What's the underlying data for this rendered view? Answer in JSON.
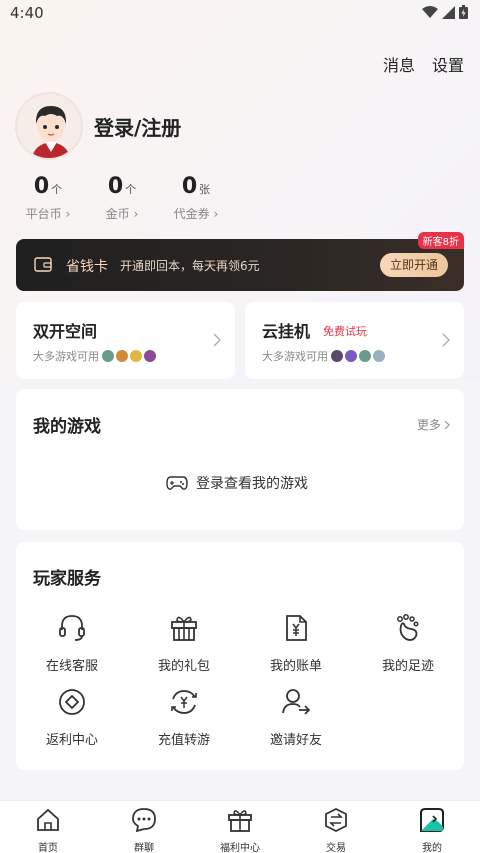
{
  "status": {
    "time": "4:40"
  },
  "header": {
    "messages_label": "消息",
    "settings_label": "设置"
  },
  "profile": {
    "login_label": "登录/注册"
  },
  "stats": [
    {
      "value": "0",
      "unit": "个",
      "label": "平台币",
      "chevron": "›"
    },
    {
      "value": "0",
      "unit": "个",
      "label": "金币",
      "chevron": "›"
    },
    {
      "value": "0",
      "unit": "张",
      "label": "代金券",
      "chevron": "›"
    }
  ],
  "money_card": {
    "title": "省钱卡",
    "description": "开通即回本，每天再领6元",
    "button": "立即开通",
    "badge": "新客8折"
  },
  "dual_space": {
    "title": "双开空间",
    "subtitle": "大多游戏可用"
  },
  "cloud_hang": {
    "title": "云挂机",
    "tag": "免费试玩",
    "subtitle": "大多游戏可用"
  },
  "my_games": {
    "title": "我的游戏",
    "more_label": "更多",
    "empty_label": "登录查看我的游戏"
  },
  "services": {
    "title": "玩家服务",
    "items": [
      {
        "label": "在线客服",
        "icon": "headset-icon"
      },
      {
        "label": "我的礼包",
        "icon": "gift-icon"
      },
      {
        "label": "我的账单",
        "icon": "bill-icon"
      },
      {
        "label": "我的足迹",
        "icon": "footprint-icon"
      },
      {
        "label": "返利中心",
        "icon": "rebate-icon"
      },
      {
        "label": "充值转游",
        "icon": "recharge-transfer-icon"
      },
      {
        "label": "邀请好友",
        "icon": "invite-friend-icon"
      }
    ]
  },
  "bottom_nav": [
    {
      "label": "首页",
      "icon": "home-icon"
    },
    {
      "label": "群聊",
      "icon": "chat-icon"
    },
    {
      "label": "福利中心",
      "icon": "gift-box-icon"
    },
    {
      "label": "交易",
      "icon": "trade-icon"
    },
    {
      "label": "我的",
      "icon": "profile-icon",
      "active": true
    }
  ],
  "colors": {
    "accent_red": "#e8324a",
    "card_dark": "#1f1f1f",
    "gold": "#f6d9bf"
  }
}
